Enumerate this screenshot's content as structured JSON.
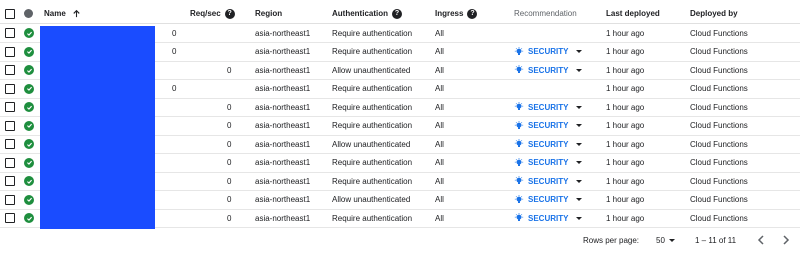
{
  "header": {
    "name": "Name",
    "req_sec": "Req/sec",
    "region": "Region",
    "authentication": "Authentication",
    "ingress": "Ingress",
    "recommendation": "Recommendation",
    "last_deployed": "Last deployed",
    "deployed_by": "Deployed by"
  },
  "rows": [
    {
      "req": "0",
      "region": "asia-northeast1",
      "auth": "Require authentication",
      "ingress": "All",
      "rec": "",
      "deployed": "1 hour ago",
      "by": "Cloud Functions"
    },
    {
      "req": "0",
      "region": "asia-northeast1",
      "auth": "Require authentication",
      "ingress": "All",
      "rec": "SECURITY",
      "deployed": "1 hour ago",
      "by": "Cloud Functions"
    },
    {
      "req": "0",
      "region": "asia-northeast1",
      "auth": "Allow unauthenticated",
      "ingress": "All",
      "rec": "SECURITY",
      "deployed": "1 hour ago",
      "by": "Cloud Functions"
    },
    {
      "req": "0",
      "region": "asia-northeast1",
      "auth": "Require authentication",
      "ingress": "All",
      "rec": "",
      "deployed": "1 hour ago",
      "by": "Cloud Functions"
    },
    {
      "req": "0",
      "region": "asia-northeast1",
      "auth": "Require authentication",
      "ingress": "All",
      "rec": "SECURITY",
      "deployed": "1 hour ago",
      "by": "Cloud Functions"
    },
    {
      "req": "0",
      "region": "asia-northeast1",
      "auth": "Require authentication",
      "ingress": "All",
      "rec": "SECURITY",
      "deployed": "1 hour ago",
      "by": "Cloud Functions"
    },
    {
      "req": "0",
      "region": "asia-northeast1",
      "auth": "Allow unauthenticated",
      "ingress": "All",
      "rec": "SECURITY",
      "deployed": "1 hour ago",
      "by": "Cloud Functions"
    },
    {
      "req": "0",
      "region": "asia-northeast1",
      "auth": "Require authentication",
      "ingress": "All",
      "rec": "SECURITY",
      "deployed": "1 hour ago",
      "by": "Cloud Functions"
    },
    {
      "req": "0",
      "region": "asia-northeast1",
      "auth": "Require authentication",
      "ingress": "All",
      "rec": "SECURITY",
      "deployed": "1 hour ago",
      "by": "Cloud Functions"
    },
    {
      "req": "0",
      "region": "asia-northeast1",
      "auth": "Allow unauthenticated",
      "ingress": "All",
      "rec": "SECURITY",
      "deployed": "1 hour ago",
      "by": "Cloud Functions"
    },
    {
      "req": "0",
      "region": "asia-northeast1",
      "auth": "Require authentication",
      "ingress": "All",
      "rec": "SECURITY",
      "deployed": "1 hour ago",
      "by": "Cloud Functions"
    }
  ],
  "footer": {
    "rows_per_page_label": "Rows per page:",
    "rows_per_page_value": "50",
    "range": "1 – 11 of 11"
  },
  "colors": {
    "status_ok": "#1e8e3e",
    "name_redaction": "#1a4cff",
    "security_link": "#1a73e8"
  },
  "icons": {
    "status": "check-circle-icon",
    "recommendation": "lightbulb-icon",
    "sort": "arrow-up-icon",
    "help": "help-circle-icon"
  }
}
